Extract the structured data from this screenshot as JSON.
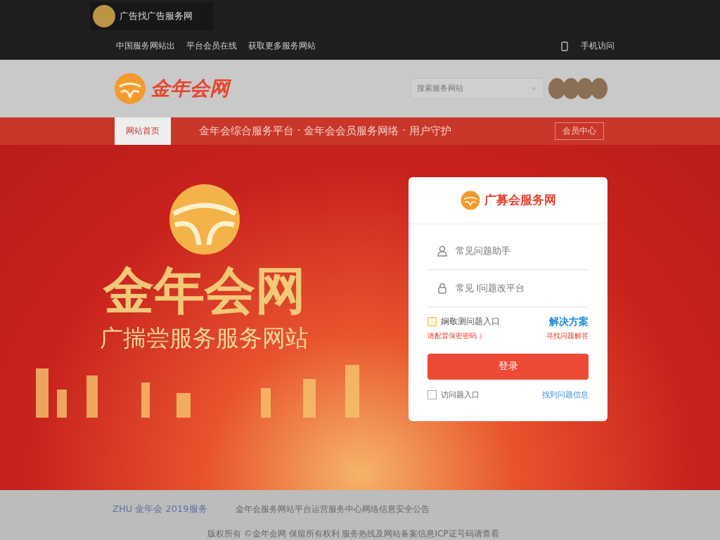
{
  "top_bar": {
    "site_name": "广告找广告服务网",
    "links": [
      "中国服务网站出",
      "平台会员在线",
      "获取更多服务网站"
    ],
    "right_text": "手机访问"
  },
  "header": {
    "logo_text": "金年会网",
    "search": {
      "placeholder": "搜索服务网站"
    }
  },
  "nav": {
    "home": "网站首页",
    "slogan": "金年会综合服务平台 · 金年会会员服务网络 · 用户守护",
    "right_link": "会员中心"
  },
  "hero": {
    "title": "金年会网",
    "subtitle": "广揣尝服务服务网站"
  },
  "login": {
    "brand": "广募会服务网",
    "fields": [
      {
        "kind": "user",
        "placeholder": "常见问题助手"
      },
      {
        "kind": "lock",
        "placeholder": "常见 I问题改平台"
      }
    ],
    "option": {
      "label": "娴敬测问题入口",
      "checked": false
    },
    "solution_link": "解决方案",
    "hint_left": "请配置保密密码 ）",
    "hint_right": "寻找问题解答",
    "submit": "登录",
    "remember": {
      "label": "访问题入口",
      "checked": false
    },
    "help_link": "找到问题信息"
  },
  "footer": {
    "brand": "ZHU 金年会 2019服务",
    "info": "金年会服务网站平台运营服务中心网络信息安全公告",
    "copyright": "版权所有 ©金年会网 保留所有权利 服务热线及网站备案信息ICP证号码请查看"
  }
}
